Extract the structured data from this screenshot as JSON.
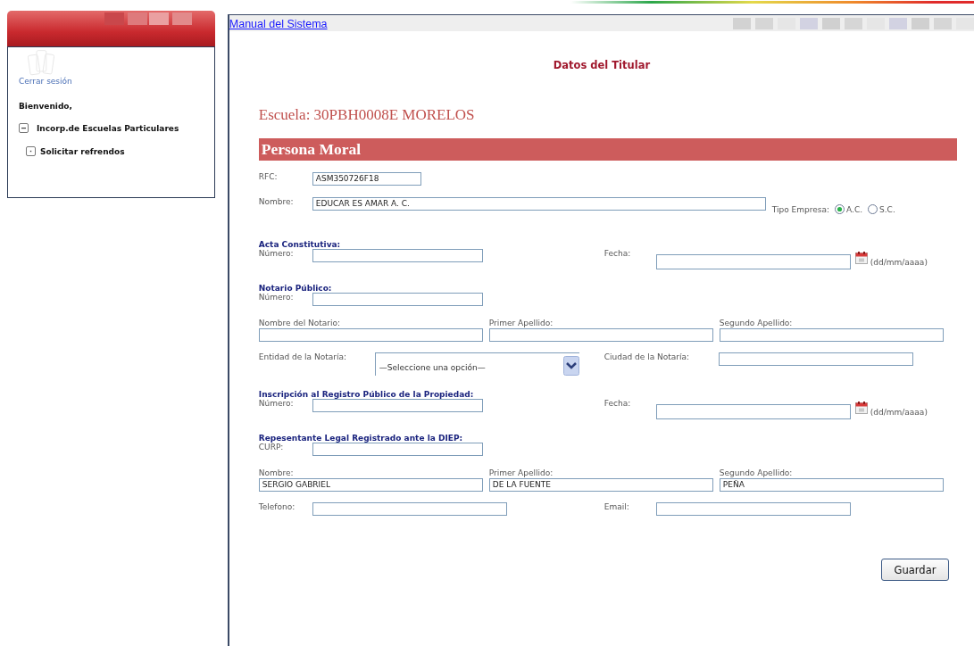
{
  "sidebar": {
    "logout_link": "Cerrar sesión",
    "welcome": "Bienvenido,",
    "menu": [
      {
        "label": "Incorp.de Escuelas Particulares",
        "expanded": true,
        "children": [
          {
            "label": "Solicitar refrendos",
            "expanded": false
          }
        ]
      }
    ]
  },
  "manual_link": "Manual del Sistema",
  "page_title": "Datos del Titular",
  "school": "Escuela: 30PBH0008E MORELOS",
  "section_title": "Persona Moral",
  "rows": [
    {
      "kind": "fields",
      "items": [
        {
          "kind": "text",
          "label": "RFC:",
          "value": "ASM350726F18"
        }
      ]
    },
    {
      "kind": "fields",
      "items": [
        {
          "kind": "text",
          "label": "Nombre:",
          "value": "EDUCAR ES AMAR A. C."
        },
        {
          "kind": "radio",
          "label": "Tipo Empresa:",
          "options": [
            {
              "label": "A.C.",
              "selected": true
            },
            {
              "label": "S.C.",
              "selected": false
            }
          ]
        }
      ]
    },
    {
      "kind": "heading",
      "text": "Acta Constitutiva:"
    },
    {
      "kind": "fields",
      "items": [
        {
          "kind": "text",
          "label": "Número:"
        },
        {
          "kind": "date",
          "label": "Fecha:",
          "hint": "(dd/mm/aaaa)"
        }
      ]
    },
    {
      "kind": "heading",
      "text": "Notario Público:"
    },
    {
      "kind": "fields",
      "items": [
        {
          "kind": "text",
          "label": "Número:"
        }
      ]
    },
    {
      "kind": "stacked",
      "items": [
        {
          "label": "Nombre del Notario:"
        },
        {
          "label": "Primer Apellido:"
        },
        {
          "label": "Segundo Apellido:"
        }
      ]
    },
    {
      "kind": "fields",
      "items": [
        {
          "kind": "select",
          "label": "Entidad de la Notaría:",
          "value": "—Seleccione una opción—"
        },
        {
          "kind": "text",
          "label": "Ciudad de la Notaría:"
        }
      ]
    },
    {
      "kind": "heading",
      "text": "Inscripción al Registro Público de la Propiedad:"
    },
    {
      "kind": "fields",
      "items": [
        {
          "kind": "text",
          "label": "Número:"
        },
        {
          "kind": "date",
          "label": "Fecha:",
          "hint": "(dd/mm/aaaa)"
        }
      ]
    },
    {
      "kind": "heading",
      "text": "Repesentante Legal Registrado ante la DIEP:"
    },
    {
      "kind": "fields",
      "items": [
        {
          "kind": "text",
          "label": "CURP:"
        }
      ]
    },
    {
      "kind": "stacked",
      "items": [
        {
          "label": "Nombre:",
          "value": "SERGIO GABRIEL"
        },
        {
          "label": "Primer Apellido:",
          "value": "DE LA FUENTE"
        },
        {
          "label": "Segundo Apellido:",
          "value": "PEÑA"
        }
      ]
    },
    {
      "kind": "fields",
      "items": [
        {
          "kind": "text",
          "label": "Telefono:"
        },
        {
          "kind": "text",
          "label": "Email:"
        }
      ]
    }
  ],
  "save_button": "Guardar"
}
